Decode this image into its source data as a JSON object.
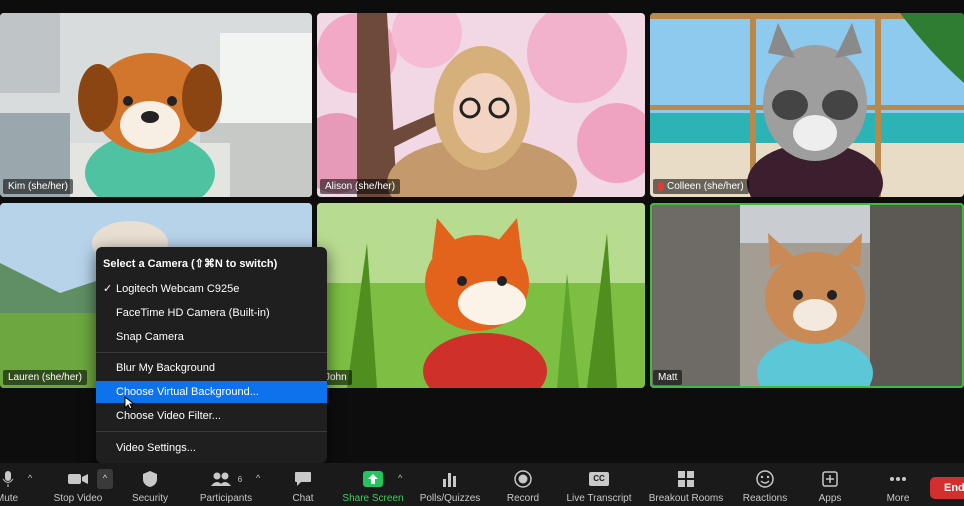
{
  "participants": [
    {
      "name": "Kim (she/her)",
      "muted": false
    },
    {
      "name": "Alison (she/her)",
      "muted": false
    },
    {
      "name": "Colleen (she/her)",
      "muted": true
    },
    {
      "name": "Lauren (she/her)",
      "muted": false
    },
    {
      "name": "John",
      "muted": false
    },
    {
      "name": "Matt",
      "muted": false
    }
  ],
  "camera_menu": {
    "header": "Select a Camera (⇧⌘N to switch)",
    "check": "✓",
    "items": [
      "Logitech Webcam C925e",
      "FaceTime HD Camera (Built-in)",
      "Snap Camera",
      "Blur My Background",
      "Choose Virtual Background...",
      "Choose Video Filter...",
      "Video Settings..."
    ],
    "selected_camera": "Logitech Webcam C925e",
    "highlighted": "Choose Virtual Background..."
  },
  "toolbar": {
    "mute": "Mute",
    "stop_video": "Stop Video",
    "security": "Security",
    "participants": "Participants",
    "participants_count": "6",
    "chat": "Chat",
    "share_screen": "Share Screen",
    "polls": "Polls/Quizzes",
    "record": "Record",
    "live_transcript": "Live Transcript",
    "cc": "CC",
    "breakout": "Breakout Rooms",
    "reactions": "Reactions",
    "apps": "Apps",
    "more": "More",
    "end": "End"
  },
  "colors": {
    "accent": "#0e72ed",
    "share": "#22c55e",
    "end": "#d32f2f",
    "active_speaker": "#3cbe3c"
  }
}
